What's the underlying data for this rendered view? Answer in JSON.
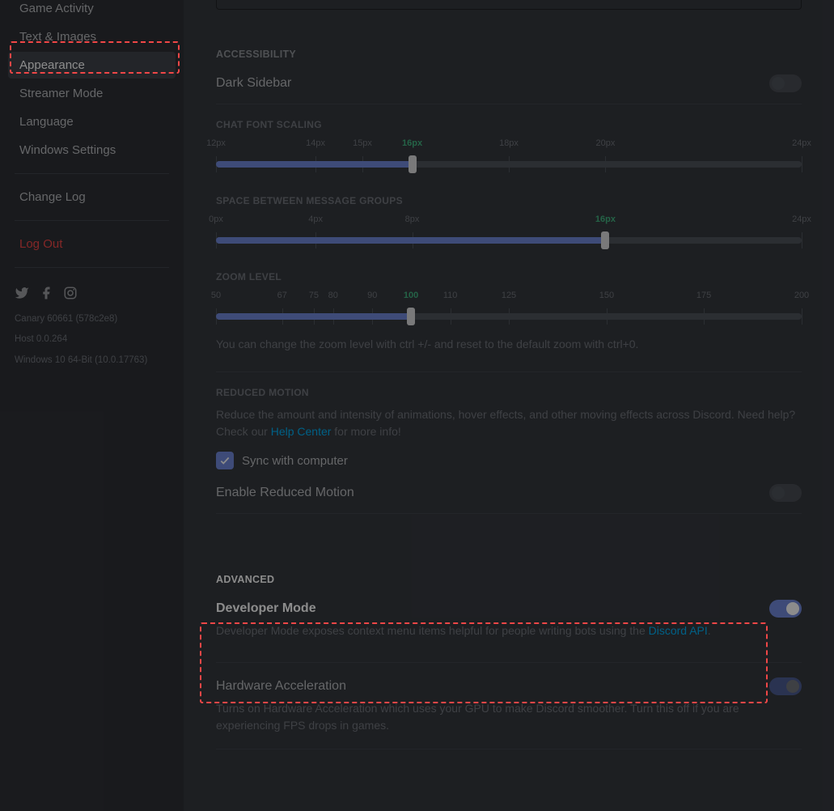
{
  "sidebar": {
    "items": [
      {
        "label": "Game Activity"
      },
      {
        "label": "Text & Images"
      },
      {
        "label": "Appearance",
        "selected": true
      },
      {
        "label": "Streamer Mode"
      },
      {
        "label": "Language"
      },
      {
        "label": "Windows Settings"
      }
    ],
    "change_log": "Change Log",
    "log_out": "Log Out",
    "meta": {
      "version": "Canary 60661 (578c2e8)",
      "host": "Host 0.0.264",
      "os": "Windows 10 64-Bit (10.0.17763)"
    }
  },
  "accessibility": {
    "title": "ACCESSIBILITY",
    "dark_sidebar": "Dark Sidebar",
    "chat_font": {
      "title": "CHAT FONT SCALING",
      "ticks": [
        "12px",
        "14px",
        "15px",
        "16px",
        "18px",
        "20px",
        "24px"
      ],
      "value_index": 3,
      "positions_pct": [
        0,
        17,
        25,
        33.5,
        50,
        66.5,
        100
      ]
    },
    "space": {
      "title": "SPACE BETWEEN MESSAGE GROUPS",
      "ticks": [
        "0px",
        "4px",
        "8px",
        "16px",
        "24px"
      ],
      "value_index": 3,
      "positions_pct": [
        0,
        17,
        33.5,
        66.5,
        100
      ]
    },
    "zoom": {
      "title": "ZOOM LEVEL",
      "ticks": [
        "50",
        "67",
        "75",
        "80",
        "90",
        "100",
        "110",
        "125",
        "150",
        "175",
        "200"
      ],
      "value_index": 5,
      "positions_pct": [
        0,
        11.3,
        16.7,
        20,
        26.7,
        33.3,
        40,
        50,
        66.7,
        83.3,
        100
      ],
      "hint": "You can change the zoom level with ctrl +/- and reset to the default zoom with ctrl+0."
    },
    "reduced": {
      "title": "REDUCED MOTION",
      "desc_a": "Reduce the amount and intensity of animations, hover effects, and other moving effects across Discord. Need help? Check our ",
      "link": "Help Center",
      "desc_b": " for more info!",
      "sync": "Sync with computer",
      "enable": "Enable Reduced Motion"
    }
  },
  "advanced": {
    "title": "ADVANCED",
    "dev": {
      "label": "Developer Mode",
      "desc_a": "Developer Mode exposes context menu items helpful for people writing bots using the ",
      "link": "Discord API",
      "desc_b": "."
    },
    "hw": {
      "label": "Hardware Acceleration",
      "desc": "Turns on Hardware Acceleration which uses your GPU to make Discord smoother. Turn this off if you are experiencing FPS drops in games."
    }
  }
}
